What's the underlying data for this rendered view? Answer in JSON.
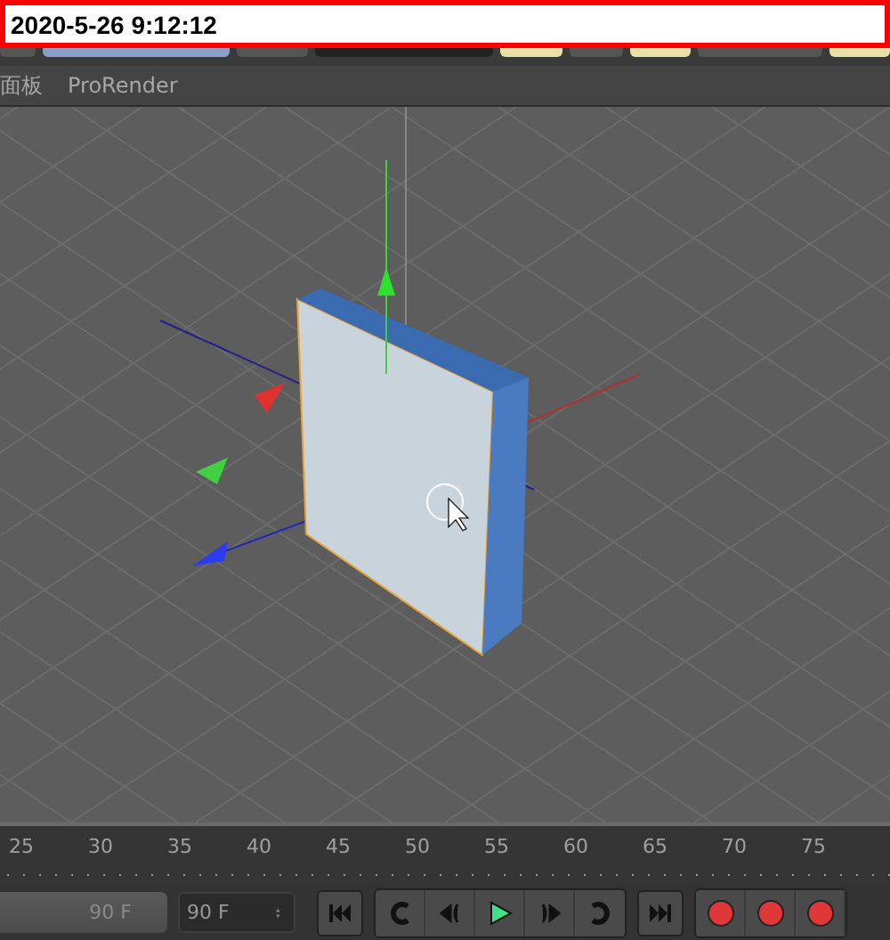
{
  "timestamp": "2020-5-26 9:12:12",
  "menu": [
    "面板",
    "ProRender"
  ],
  "timeline": {
    "ticks": [
      "25",
      "30",
      "35",
      "40",
      "45",
      "50",
      "55",
      "60",
      "65",
      "70",
      "75"
    ]
  },
  "controls": {
    "end_slider": {
      "value": "90 F",
      "level": 1
    },
    "end_field": {
      "value": "90 F"
    }
  }
}
